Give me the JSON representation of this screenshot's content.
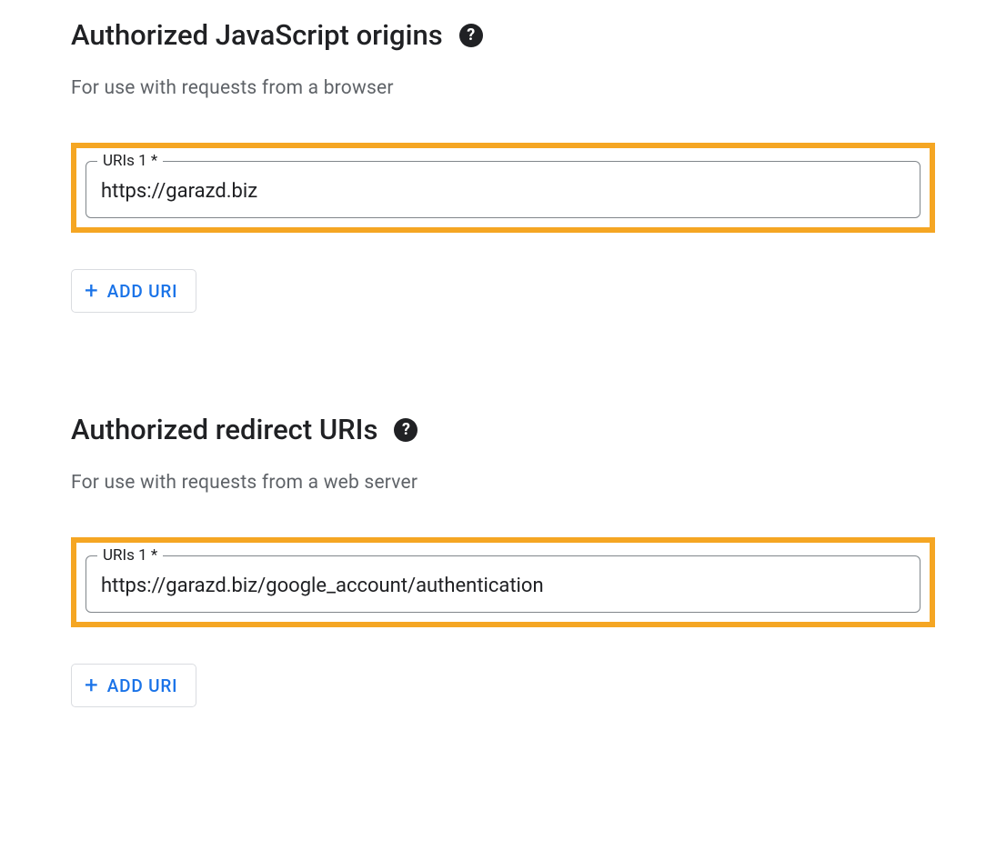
{
  "sections": {
    "js_origins": {
      "title": "Authorized JavaScript origins",
      "subtitle": "For use with requests from a browser",
      "field_label": "URIs 1 *",
      "field_value": "https://garazd.biz",
      "add_button_label": "ADD URI"
    },
    "redirect_uris": {
      "title": "Authorized redirect URIs",
      "subtitle": "For use with requests from a web server",
      "field_label": "URIs 1 *",
      "field_value": "https://garazd.biz/google_account/authentication",
      "add_button_label": "ADD URI"
    }
  },
  "help_icon_char": "?"
}
